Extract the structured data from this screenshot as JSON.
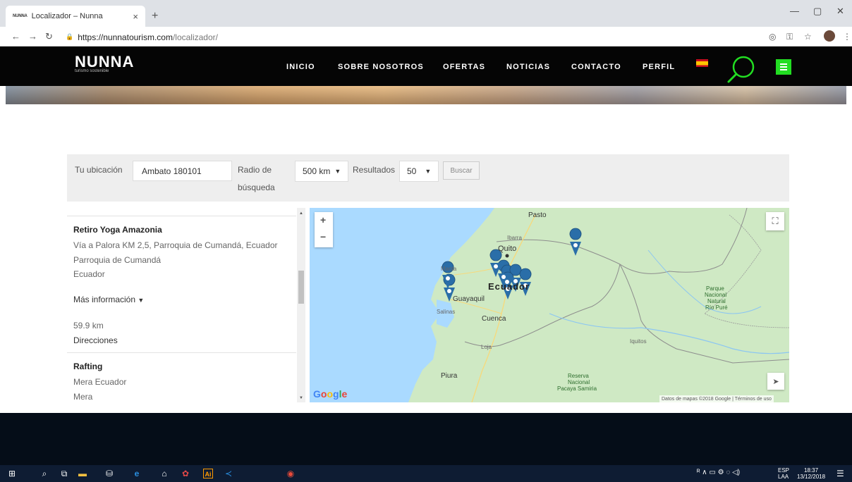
{
  "browser": {
    "tab_title": "Localizador – Nunna",
    "tab_favicon": "NUNNA",
    "url_host": "https://nunnatourism.com",
    "url_path": "/localizador/"
  },
  "site": {
    "logo": "NUNNA",
    "logo_subtitle": "turismo sostenible",
    "menu": [
      "INICIO",
      "SOBRE NOSOTROS",
      "OFERTAS",
      "NOTICIAS",
      "CONTACTO",
      "PERFIL"
    ]
  },
  "form": {
    "location_label": "Tu ubicación",
    "location_value": "Ambato 180101",
    "radius_label_1": "Radio de",
    "radius_label_2": "búsqueda",
    "radius_value": "500 km",
    "results_label": "Resultados",
    "results_value": "50",
    "search_button": "Buscar"
  },
  "results": [
    {
      "name": "Retiro Yoga Amazonia",
      "address": "Vía a Palora KM 2,5, Parroquia de Cumandá, Ecuador",
      "city": "Parroquia de Cumandá",
      "country": "Ecuador",
      "more_info": "Más información",
      "distance": "59.9 km",
      "directions": "Direcciones"
    },
    {
      "name": "Rafting",
      "address": "Mera Ecuador",
      "city": "Mera"
    }
  ],
  "map": {
    "labels": {
      "pasto": "Pasto",
      "ibarra": "Ibarra",
      "quito": "Quito",
      "manta": "Manta",
      "ecuador": "Ecuador",
      "guayaquil": "Guayaquil",
      "salinas": "Salinas",
      "cuenca": "Cuenca",
      "loja": "Loja",
      "piura": "Piura",
      "iquitos": "Iquitos",
      "parque": "Parque",
      "nacional": "Nacional",
      "natural": "Natural",
      "rio_pure": "Río Puré",
      "reserva": "Reserva",
      "pacaya": "Pacaya Samiria"
    },
    "google": "Google",
    "attribution": "Datos de mapas ©2018 Google | Términos de uso",
    "zoom_in": "+",
    "zoom_out": "−",
    "marker_color": "#2a6ea8",
    "water_color": "#aadaff",
    "land_color": "#cfe9c4"
  },
  "taskbar": {
    "lang": "ESP",
    "lang2": "LAA",
    "time": "18:37",
    "date": "13/12/2018"
  }
}
